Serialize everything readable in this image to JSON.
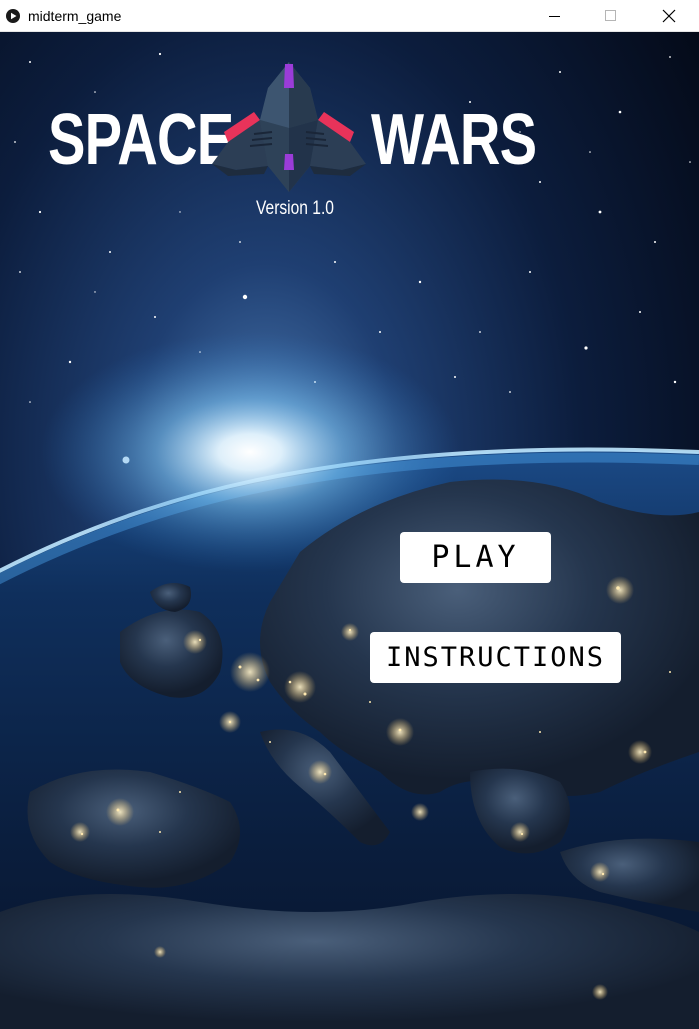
{
  "window": {
    "title": "midterm_game",
    "icon": "processing-play-icon",
    "controls": [
      "minimize-icon",
      "maximize-icon",
      "close-icon"
    ]
  },
  "logo": {
    "word_left": "SPACE",
    "word_right": "WARS",
    "version": "Version 1.0",
    "ship_icon": "spaceship-icon"
  },
  "menu": {
    "play_label": "PLAY",
    "instructions_label": "INSTRUCTIONS"
  },
  "background": {
    "description_icon": "earth-from-space-background",
    "space_color": "#050d1f",
    "glow_color": "#bfe8ff",
    "ship_accent_color": "#e8335a",
    "ship_purple_color": "#9b3cd8",
    "ship_body_color": "#2c3e55"
  }
}
